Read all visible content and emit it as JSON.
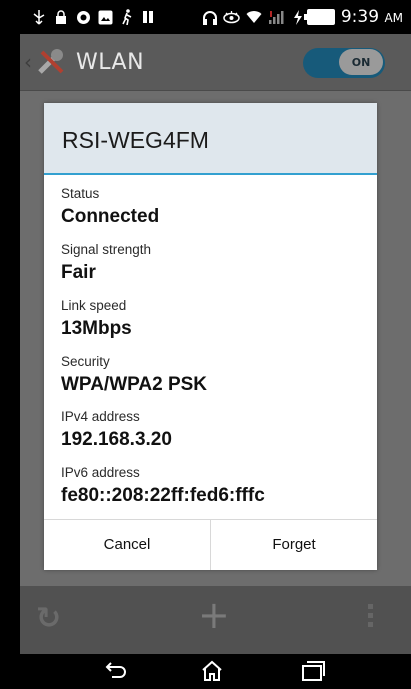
{
  "status_bar": {
    "time": "9:39",
    "ampm": "AM",
    "icons": [
      "usb-icon",
      "lock-icon",
      "circle-icon",
      "image-icon",
      "person-icon",
      "bars-icon",
      "headphones-icon",
      "eye-icon",
      "wifi-icon",
      "signal-icon",
      "charging-icon",
      "battery-icon"
    ]
  },
  "app": {
    "title": "WLAN",
    "toggle_label": "ON"
  },
  "dialog": {
    "title": "RSI-WEG4FM",
    "fields": [
      {
        "label": "Status",
        "value": "Connected"
      },
      {
        "label": "Signal strength",
        "value": "Fair"
      },
      {
        "label": "Link speed",
        "value": "13Mbps"
      },
      {
        "label": "Security",
        "value": "WPA/WPA2 PSK"
      },
      {
        "label": "IPv4 address",
        "value": "192.168.3.20"
      },
      {
        "label": "IPv6 address",
        "value": "fe80::208:22ff:fed6:fffc"
      }
    ],
    "buttons": {
      "cancel": "Cancel",
      "forget": "Forget"
    }
  },
  "colors": {
    "accent": "#33a0d0",
    "dialog_header": "#dfe7ed",
    "toggle_on": "#175a7a"
  }
}
